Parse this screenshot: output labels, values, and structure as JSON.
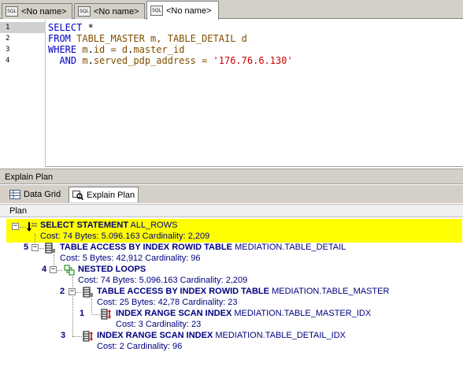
{
  "tabs": [
    {
      "label": "<No name>",
      "icon": "sql-icon"
    },
    {
      "label": "<No name>",
      "icon": "sql-icon"
    },
    {
      "label": "<No name>",
      "icon": "sql-icon"
    }
  ],
  "sql_icon_text": "SQL",
  "editor": {
    "line_numbers": [
      "1",
      "2",
      "3",
      "4"
    ],
    "line1": {
      "kw": "SELECT",
      "rest": " *"
    },
    "line2": {
      "kw": "FROM",
      "rest": " TABLE_MASTER m, TABLE_DETAIL d"
    },
    "line3": {
      "kw": "WHERE",
      "a": " m",
      "dot1": ".",
      "b": "id = d",
      "dot2": ".",
      "c": "master_id"
    },
    "line4": {
      "kw": "  AND",
      "a": " m",
      "dot": ".",
      "b": "served_pdp_address = ",
      "str": "'176.76.6.130'"
    }
  },
  "explain_header": "Explain Plan",
  "subtabs": [
    {
      "label": "Data Grid",
      "icon": "grid-icon"
    },
    {
      "label": "Explain Plan",
      "icon": "explain-plan-icon"
    }
  ],
  "plan_label": "Plan",
  "plan": {
    "root": {
      "op": "SELECT STATEMENT",
      "opt": "ALL_ROWS",
      "stats": "Cost: 74  Bytes: 5.096.163  Cardinality: 2,209"
    },
    "nodes": [
      {
        "num": "5",
        "op": "TABLE ACCESS BY INDEX ROWID TABLE",
        "obj": "MEDIATION.TABLE_DETAIL",
        "stats": "Cost: 5  Bytes: 42,912  Cardinality: 96"
      },
      {
        "num": "4",
        "op": "NESTED LOOPS",
        "obj": "",
        "stats": "Cost: 74  Bytes: 5.096.163  Cardinality: 2,209"
      },
      {
        "num": "2",
        "op": "TABLE ACCESS BY INDEX ROWID TABLE",
        "obj": "MEDIATION.TABLE_MASTER",
        "stats": "Cost: 25  Bytes: 42,78  Cardinality: 23"
      },
      {
        "num": "1",
        "op": "INDEX RANGE SCAN INDEX",
        "obj": "MEDIATION.TABLE_MASTER_IDX",
        "stats": "Cost: 3  Cardinality: 23"
      },
      {
        "num": "3",
        "op": "INDEX RANGE SCAN INDEX",
        "obj": "MEDIATION.TABLE_DETAIL_IDX",
        "stats": "Cost: 2  Cardinality: 96"
      }
    ]
  },
  "colors": {
    "highlight": "#ffff00",
    "keyword": "#0000c8",
    "string": "#c80000",
    "identifier": "#805000",
    "plan_text": "#000080"
  }
}
